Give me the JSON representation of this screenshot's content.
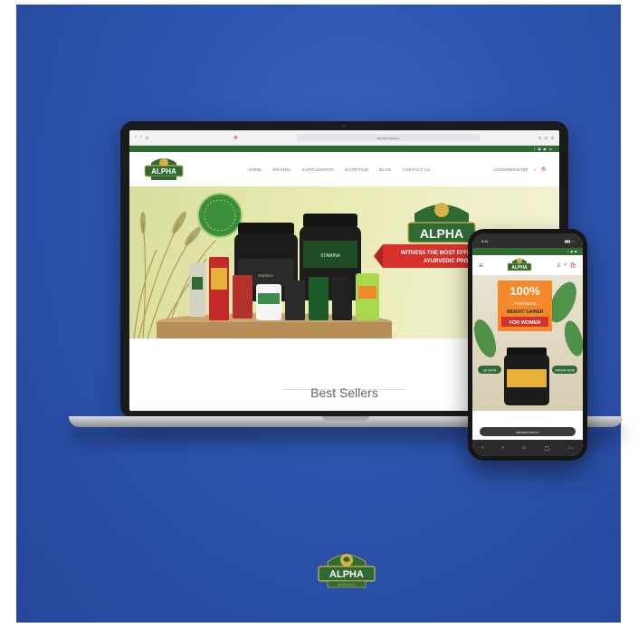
{
  "laptop": {
    "browser": {
      "url": "alphaherbal.in"
    },
    "social": [
      "f",
      "◉",
      "▶",
      "in"
    ],
    "logo_text": "ALPHA",
    "nav": [
      "HOME",
      "BRANDS",
      "SUPPLEMENTS",
      "NUTRITION",
      "BLOG",
      "CONTACT US"
    ],
    "header_right": {
      "account": "LOGIN/REGISTER",
      "cart_count": "0"
    },
    "hero": {
      "brand_badge": "ALPHA",
      "banner_text_line1": "WITNESS THE MOST EFFECTIVE",
      "banner_text_line2": "AYURVEDIC PRODUCTS",
      "product_label_1": "ENERGY",
      "product_label_2": "STAMINA"
    },
    "section_title": "Best Sellers"
  },
  "phone": {
    "status_time": "9:41",
    "status_icons": "▮▮▮ ◔",
    "logo_text": "ALPHA",
    "hero": {
      "percent": "100%",
      "line1": "AYURVEDIC",
      "line2": "WEIGHT GAINER",
      "line3": "FOR WOMEN",
      "pill_left": "30 CAPS",
      "pill_right": "ORDER NOW"
    },
    "url": "alphaherbal.in",
    "bottom_nav": [
      "‹",
      "›",
      "⌂",
      "▢",
      "⋯"
    ]
  },
  "brand": {
    "logo_text": "ALPHA",
    "logo_sub": "AYURVEDIC"
  },
  "colors": {
    "background": "#2d54ad",
    "brand_green": "#2f6a33",
    "accent_red": "#d7312c",
    "accent_orange": "#f28a2b",
    "logo_gold": "#d7b24a"
  }
}
